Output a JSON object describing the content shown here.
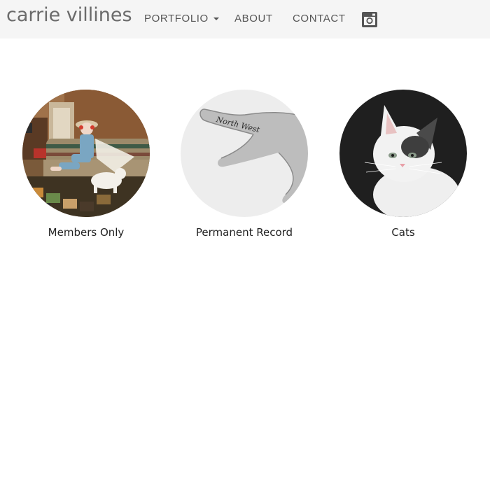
{
  "header": {
    "brand": "carrie villines",
    "nav": {
      "portfolio": "PORTFOLIO",
      "about": "ABOUT",
      "contact": "CONTACT"
    },
    "social_icon": "instagram-icon"
  },
  "gallery": {
    "items": [
      {
        "caption": "Members Only",
        "image": "woman-with-cat-on-couch-photo"
      },
      {
        "caption": "Permanent Record",
        "image": "tattooed-finger-photo",
        "tattoo_text": "North West"
      },
      {
        "caption": "Cats",
        "image": "white-kitten-photo"
      }
    ]
  },
  "colors": {
    "navbar_bg": "#f5f5f5",
    "nav_text": "#555555",
    "brand_text": "#6b6b6b",
    "caption_text": "#222222"
  }
}
